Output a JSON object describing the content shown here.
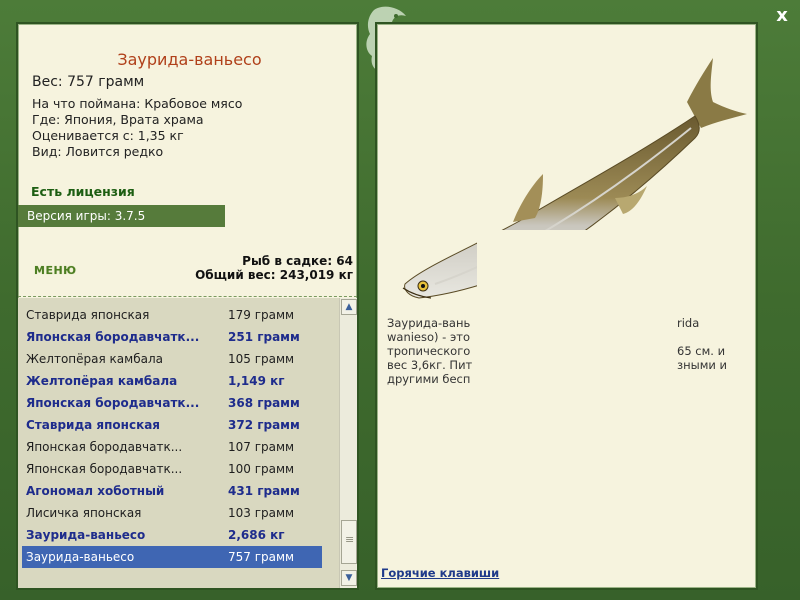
{
  "window": {
    "close_label": "x"
  },
  "fish": {
    "title": "Заурида-ваньесо",
    "weight": "Вес: 757 грамм",
    "bait": "На что поймана: Крабовое мясо",
    "place": "Где: Япония, Врата храма",
    "value": "Оценивается с: 1,35 кг",
    "rarity": "Вид: Ловится редко"
  },
  "license": "Есть лицензия",
  "version": "Версия игры: 3.7.5",
  "menu_label": "МЕНЮ",
  "stats": {
    "count": "Рыб в садке: 64",
    "total_weight": "Общий вес: 243,019 кг"
  },
  "catch_list": [
    {
      "name": "Ставрида японская",
      "weight": "179 грамм",
      "bold": false
    },
    {
      "name": "Японская бородавчатк...",
      "weight": "251 грамм",
      "bold": true
    },
    {
      "name": "Желтопёрая камбала",
      "weight": "105 грамм",
      "bold": false
    },
    {
      "name": "Желтопёрая камбала",
      "weight": "1,149 кг",
      "bold": true
    },
    {
      "name": "Японская бородавчатк...",
      "weight": "368 грамм",
      "bold": true
    },
    {
      "name": "Ставрида японская",
      "weight": "372 грамм",
      "bold": true
    },
    {
      "name": "Японская бородавчатк...",
      "weight": "107 грамм",
      "bold": false
    },
    {
      "name": "Японская бородавчатк...",
      "weight": "100 грамм",
      "bold": false
    },
    {
      "name": "Агономал хоботный",
      "weight": "431 грамм",
      "bold": true
    },
    {
      "name": "Лисичка японская",
      "weight": "103 грамм",
      "bold": false
    },
    {
      "name": "Заурида-ваньесо",
      "weight": "2,686 кг",
      "bold": true
    },
    {
      "name": "Заурида-ваньесо",
      "weight": "757 грамм",
      "bold": false,
      "selected": true
    }
  ],
  "description": {
    "l1a": "Заурида-вань",
    "l1b": "rida",
    "l2a": "wanieso) - это",
    "l3a": "тропического",
    "l3b": "65 см. и",
    "l4a": "вес 3,6кг. Пит",
    "l4b": "зными и",
    "l5a": "другими бесп"
  },
  "hotkeys_label": "Горячие клавиши",
  "icons": {
    "close": "close-icon",
    "logo": "seahorse-logo-icon",
    "scroll_up": "chevron-up-icon",
    "scroll_down": "chevron-down-icon"
  }
}
